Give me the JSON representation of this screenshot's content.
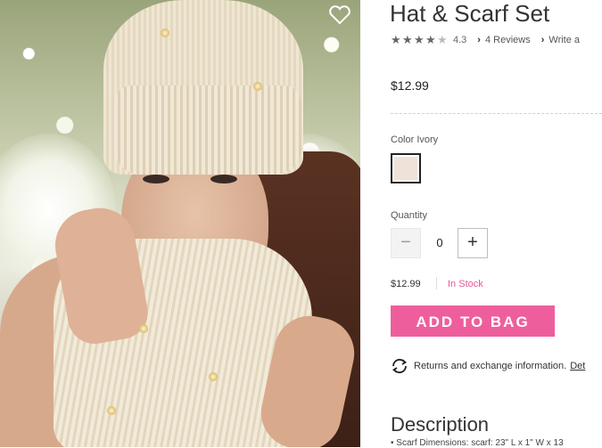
{
  "product": {
    "title": "Hat & Scarf Set",
    "rating_value": "4.3",
    "reviews_link": "4 Reviews",
    "write_link": "Write a",
    "price": "$12.99"
  },
  "options": {
    "color_label": "Color Ivory",
    "swatch_color": "#efe3d9",
    "quantity_label": "Quantity",
    "quantity_minus": "−",
    "quantity_value": "0",
    "quantity_plus": "+"
  },
  "purchase": {
    "price": "$12.99",
    "stock_status": "In Stock",
    "add_button": "ADD TO BAG",
    "accent_color": "#ee5e9d"
  },
  "returns": {
    "text": "Returns and exchange information.",
    "details_link": "Det"
  },
  "description": {
    "title": "Description",
    "first_item": "• Scarf Dimensions: scarf: 23\" L x 1\" W x 13"
  },
  "image": {
    "alt": "Model wearing ivory knit beanie and scarf"
  }
}
